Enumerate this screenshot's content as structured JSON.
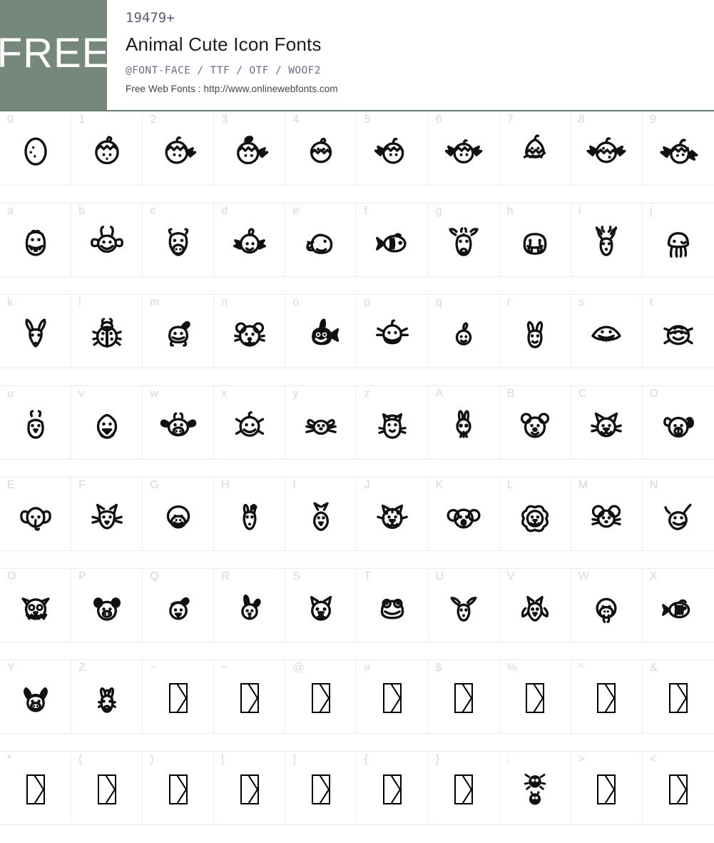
{
  "header": {
    "badge_label": "FREE",
    "glyph_count": "19479+",
    "font_title": "Animal Cute Icon Fonts",
    "formats": "@FONT-FACE / TTF / OTF / WOOF2",
    "source": "Free Web Fonts : http://www.onlinewebfonts.com",
    "accent_color": "#76877c",
    "count_color": "#5a5a73",
    "formats_color": "#6d6d8c"
  },
  "grid": {
    "columns": 10,
    "rows": [
      {
        "cells": [
          {
            "label": "0",
            "glyph": "egg"
          },
          {
            "label": "1",
            "glyph": "chick-hatching"
          },
          {
            "label": "2",
            "glyph": "chick-one-wing"
          },
          {
            "label": "3",
            "glyph": "chick-wing-tuft"
          },
          {
            "label": "4",
            "glyph": "chick-shell"
          },
          {
            "label": "5",
            "glyph": "chick-left-wing"
          },
          {
            "label": "6",
            "glyph": "chick-two-wings"
          },
          {
            "label": "7",
            "glyph": "chick-in-shell"
          },
          {
            "label": "8",
            "glyph": "chick-wings-shell"
          },
          {
            "label": "9",
            "glyph": "chick-flapping"
          }
        ]
      },
      {
        "cells": [
          {
            "label": "a",
            "glyph": "alligator"
          },
          {
            "label": "b",
            "glyph": "bee"
          },
          {
            "label": "c",
            "glyph": "camel"
          },
          {
            "label": "d",
            "glyph": "duck"
          },
          {
            "label": "e",
            "glyph": "elephant-seal"
          },
          {
            "label": "f",
            "glyph": "fish"
          },
          {
            "label": "g",
            "glyph": "giraffe"
          },
          {
            "label": "h",
            "glyph": "hippo"
          },
          {
            "label": "i",
            "glyph": "impala-deer"
          },
          {
            "label": "j",
            "glyph": "jellyfish"
          }
        ]
      },
      {
        "cells": [
          {
            "label": "k",
            "glyph": "kangaroo"
          },
          {
            "label": "l",
            "glyph": "ladybug"
          },
          {
            "label": "m",
            "glyph": "manatee"
          },
          {
            "label": "n",
            "glyph": "mouse-bear"
          },
          {
            "label": "o",
            "glyph": "orca"
          },
          {
            "label": "p",
            "glyph": "platypus"
          },
          {
            "label": "q",
            "glyph": "quail"
          },
          {
            "label": "r",
            "glyph": "rabbit"
          },
          {
            "label": "s",
            "glyph": "stingray"
          },
          {
            "label": "t",
            "glyph": "turtle"
          }
        ]
      },
      {
        "cells": [
          {
            "label": "u",
            "glyph": "urchin-bird"
          },
          {
            "label": "v",
            "glyph": "vulture"
          },
          {
            "label": "w",
            "glyph": "cow"
          },
          {
            "label": "x",
            "glyph": "x-ray-fish"
          },
          {
            "label": "y",
            "glyph": "yak-mouse"
          },
          {
            "label": "z",
            "glyph": "zebra-cat"
          },
          {
            "label": "A",
            "glyph": "bunny"
          },
          {
            "label": "B",
            "glyph": "bear"
          },
          {
            "label": "C",
            "glyph": "cat"
          },
          {
            "label": "D",
            "glyph": "dog"
          }
        ]
      },
      {
        "cells": [
          {
            "label": "E",
            "glyph": "elephant"
          },
          {
            "label": "F",
            "glyph": "fox"
          },
          {
            "label": "G",
            "glyph": "gorilla"
          },
          {
            "label": "H",
            "glyph": "horse"
          },
          {
            "label": "I",
            "glyph": "ibis"
          },
          {
            "label": "J",
            "glyph": "jaguar"
          },
          {
            "label": "K",
            "glyph": "koala"
          },
          {
            "label": "L",
            "glyph": "lion"
          },
          {
            "label": "M",
            "glyph": "mouse"
          },
          {
            "label": "N",
            "glyph": "narwhal"
          }
        ]
      },
      {
        "cells": [
          {
            "label": "O",
            "glyph": "owl"
          },
          {
            "label": "P",
            "glyph": "pig"
          },
          {
            "label": "Q",
            "glyph": "quokka"
          },
          {
            "label": "R",
            "glyph": "rabbit-head"
          },
          {
            "label": "S",
            "glyph": "squirrel"
          },
          {
            "label": "T",
            "glyph": "toad"
          },
          {
            "label": "U",
            "glyph": "unicorn-goat"
          },
          {
            "label": "V",
            "glyph": "vampire-bat"
          },
          {
            "label": "W",
            "glyph": "walrus"
          },
          {
            "label": "X",
            "glyph": "x-fish"
          }
        ]
      },
      {
        "cells": [
          {
            "label": "Y",
            "glyph": "yak"
          },
          {
            "label": "Z",
            "glyph": "zebra"
          },
          {
            "label": "~",
            "glyph": "missing"
          },
          {
            "label": "~",
            "glyph": "missing"
          },
          {
            "label": "@",
            "glyph": "missing"
          },
          {
            "label": "#",
            "glyph": "missing"
          },
          {
            "label": "$",
            "glyph": "missing"
          },
          {
            "label": "%",
            "glyph": "missing"
          },
          {
            "label": "^",
            "glyph": "missing"
          },
          {
            "label": "&",
            "glyph": "missing"
          }
        ]
      },
      {
        "cells": [
          {
            "label": "*",
            "glyph": "missing"
          },
          {
            "label": "(",
            "glyph": "missing"
          },
          {
            "label": ")",
            "glyph": "missing"
          },
          {
            "label": "[",
            "glyph": "missing"
          },
          {
            "label": "]",
            "glyph": "missing"
          },
          {
            "label": "{",
            "glyph": "missing"
          },
          {
            "label": "}",
            "glyph": "missing"
          },
          {
            "label": ":",
            "glyph": "two-bugs"
          },
          {
            "label": ">",
            "glyph": "missing"
          },
          {
            "label": "<",
            "glyph": "missing"
          }
        ]
      }
    ]
  }
}
